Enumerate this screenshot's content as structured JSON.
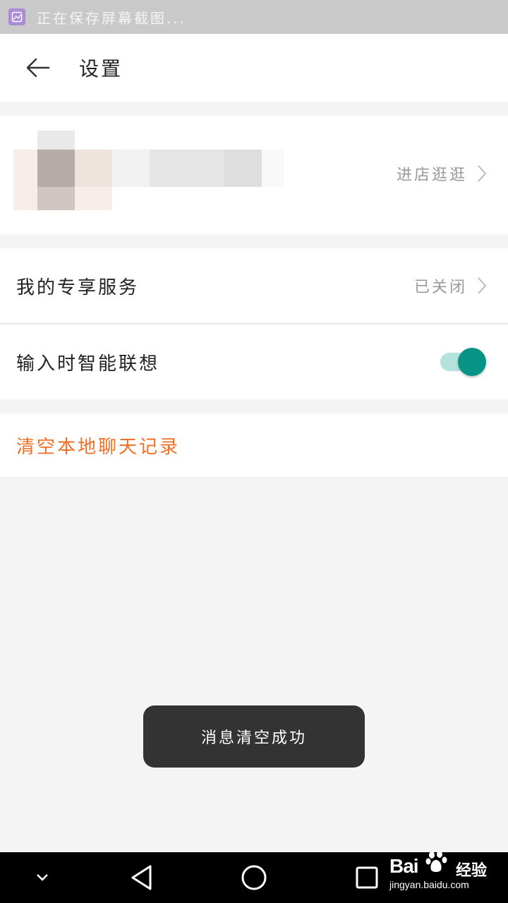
{
  "status_bar": {
    "text": "正在保存屏幕截图..."
  },
  "app_bar": {
    "title": "设置"
  },
  "shop": {
    "link_label": "进店逛逛"
  },
  "rows": {
    "exclusive_service": {
      "label": "我的专享服务",
      "value": "已关闭"
    },
    "smart_suggest": {
      "label": "输入时智能联想",
      "enabled": true
    },
    "clear_history": {
      "label": "清空本地聊天记录"
    }
  },
  "toast": {
    "text": "消息清空成功"
  },
  "watermark": {
    "brand": "Bai",
    "jingyan": "经验",
    "url": "jingyan.baidu.com"
  },
  "colors": {
    "accent_teal": "#079485",
    "danger_orange": "#f26f27",
    "status_bar": "#c9c9c9"
  },
  "icons": {
    "status": "screenshot-icon",
    "back": "arrow-left-icon",
    "chevron": "chevron-right-icon",
    "nav_down": "chevron-down-icon",
    "nav_back": "triangle-back-icon",
    "nav_home": "circle-home-icon",
    "nav_recent": "square-recent-icon"
  }
}
